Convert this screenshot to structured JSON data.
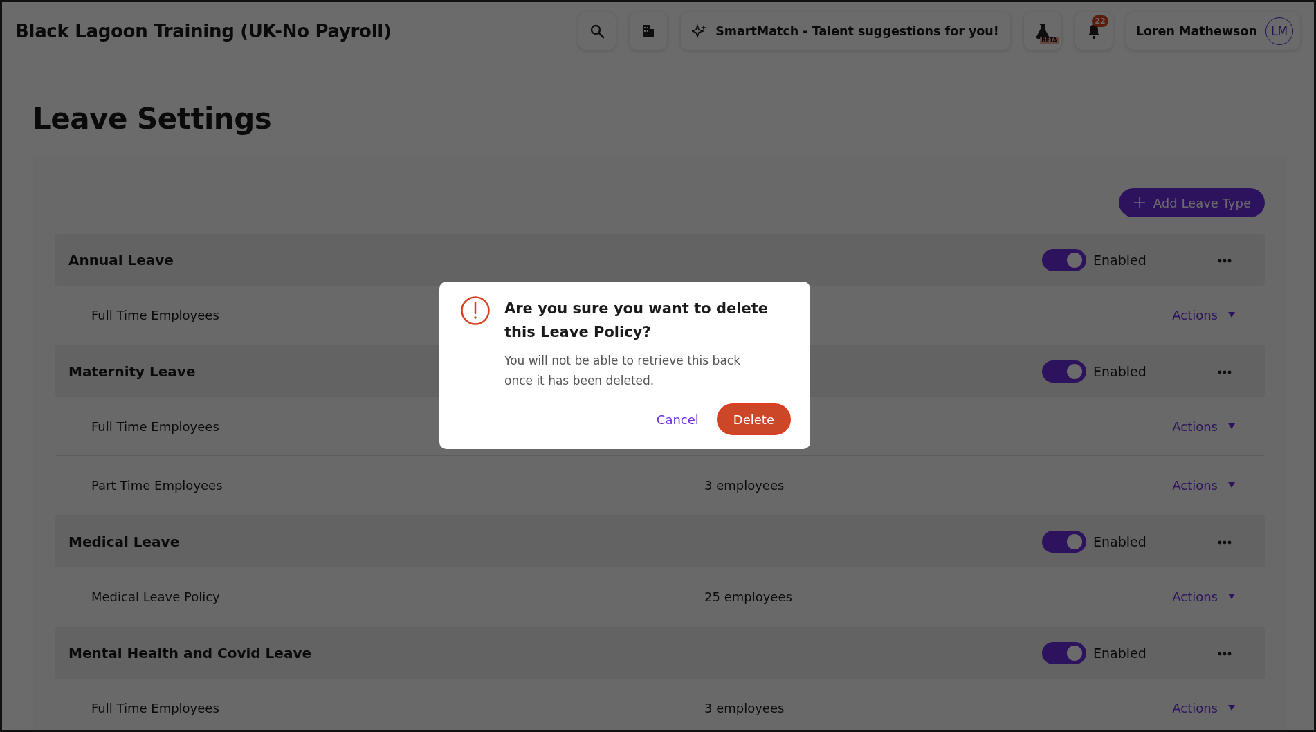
{
  "header": {
    "title": "Black Lagoon Training (UK-No Payroll)",
    "smartmatch": "SmartMatch - Talent suggestions for you!",
    "beta_badge": "BETA",
    "notification_count": "22",
    "user_name": "Loren Mathewson",
    "avatar_initials": "LM"
  },
  "page": {
    "title": "Leave Settings",
    "add_button": "Add Leave Type"
  },
  "leave_types": [
    {
      "name": "Annual Leave",
      "enabled": true,
      "status": "Enabled",
      "policies": [
        {
          "name": "Full Time Employees",
          "actions": "Actions"
        }
      ]
    },
    {
      "name": "Maternity Leave",
      "enabled": true,
      "status": "Enabled",
      "policies": [
        {
          "name": "Full Time Employees",
          "actions": "Actions"
        },
        {
          "name": "Part Time Employees",
          "count": "3 employees",
          "actions": "Actions"
        }
      ]
    },
    {
      "name": "Medical Leave",
      "enabled": true,
      "status": "Enabled",
      "policies": [
        {
          "name": "Medical Leave Policy",
          "count": "25 employees",
          "actions": "Actions"
        }
      ]
    },
    {
      "name": "Mental Health and Covid Leave",
      "enabled": true,
      "status": "Enabled",
      "policies": [
        {
          "name": "Full Time Employees",
          "count": "3 employees",
          "actions": "Actions"
        }
      ]
    }
  ],
  "dialog": {
    "title": "Are you sure you want to delete this Leave Policy?",
    "message": "You will not be able to retrieve this back once it has been deleted.",
    "cancel": "Cancel",
    "confirm": "Delete"
  }
}
